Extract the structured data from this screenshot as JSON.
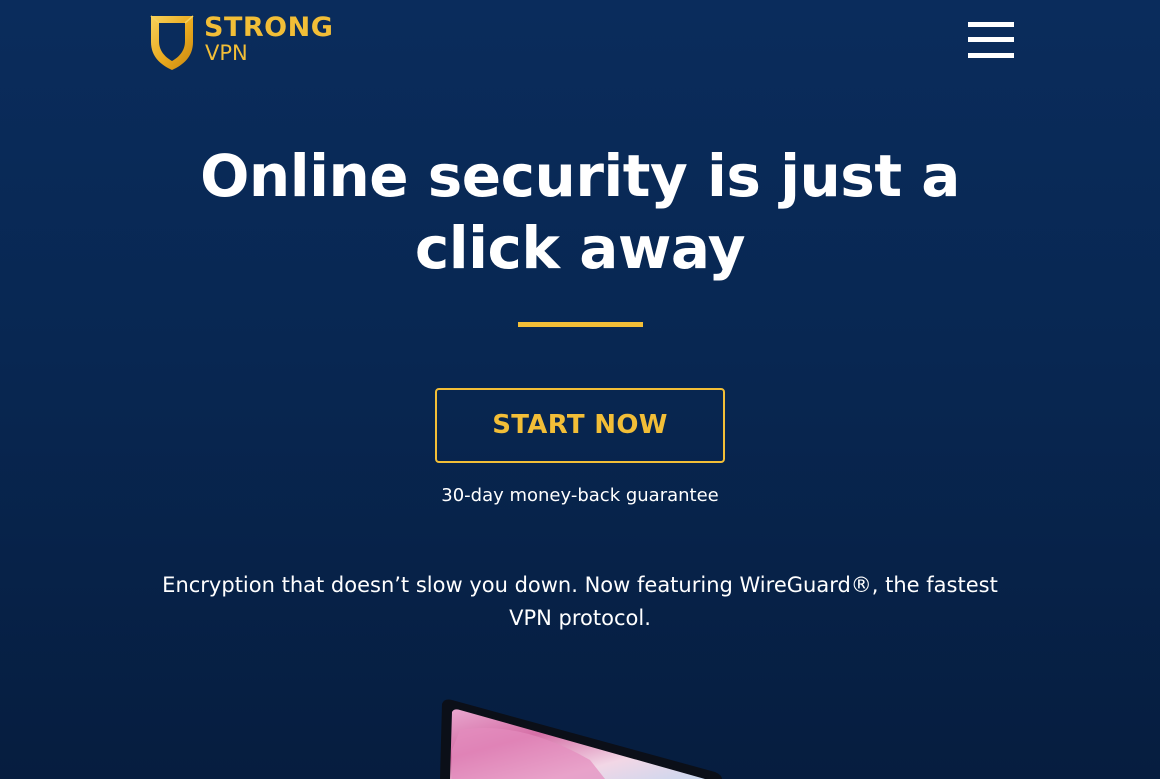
{
  "brand": {
    "name_line1": "STRONG",
    "name_line2": "VPN",
    "shield_color": "#f2be37"
  },
  "header": {
    "menu_icon": "hamburger-menu-icon"
  },
  "hero": {
    "headline": "Online security is just a click away",
    "cta_label": "START NOW",
    "guarantee": "30-day money-back guarantee",
    "tagline": "Encryption that doesn’t slow you down. Now featuring WireGuard®, the fastest VPN protocol."
  },
  "colors": {
    "background": "#082752",
    "accent": "#f2be37",
    "text": "#ffffff"
  }
}
